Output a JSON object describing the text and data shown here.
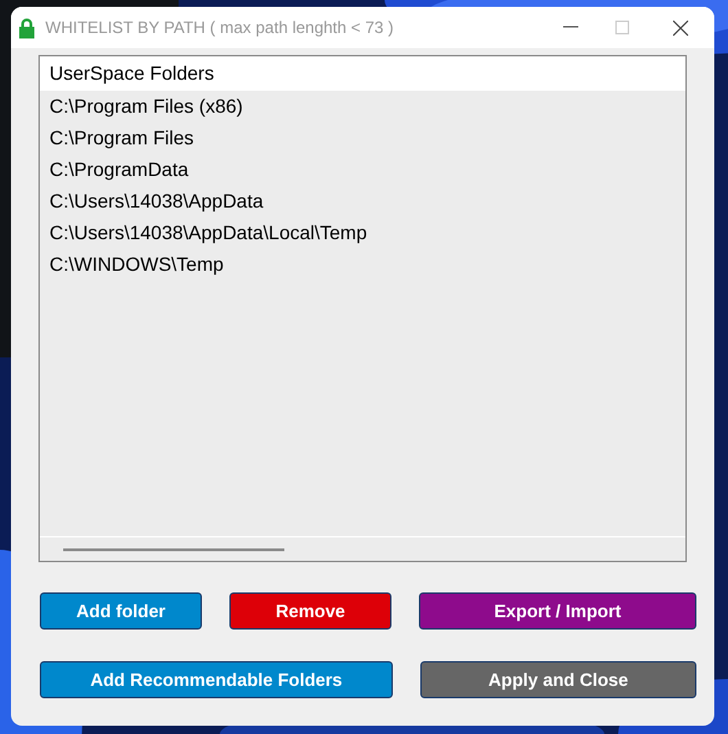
{
  "window": {
    "title": "WHITELIST BY PATH ( max path lenghth < 73 )"
  },
  "list": {
    "header": "UserSpace Folders",
    "items": [
      {
        "text": "C:\\Program Files (x86)"
      },
      {
        "text": "C:\\Program Files"
      },
      {
        "text": "C:\\ProgramData"
      },
      {
        "text": "C:\\Users\\14038\\AppData"
      },
      {
        "text": "C:\\Users\\14038\\AppData\\Local\\Temp"
      },
      {
        "text": "C:\\WINDOWS\\Temp"
      }
    ]
  },
  "button_rows": [
    [
      {
        "label": "Add folder",
        "color": "#0088cc"
      },
      {
        "label": "Remove",
        "color": "#dd0008"
      },
      {
        "label": "Export / Import",
        "color": "#8e0b8c"
      }
    ],
    [
      {
        "label": "Add Recommendable Folders",
        "color": "#0088cc"
      },
      {
        "label": "Apply and Close",
        "color": "#666666"
      }
    ]
  ]
}
